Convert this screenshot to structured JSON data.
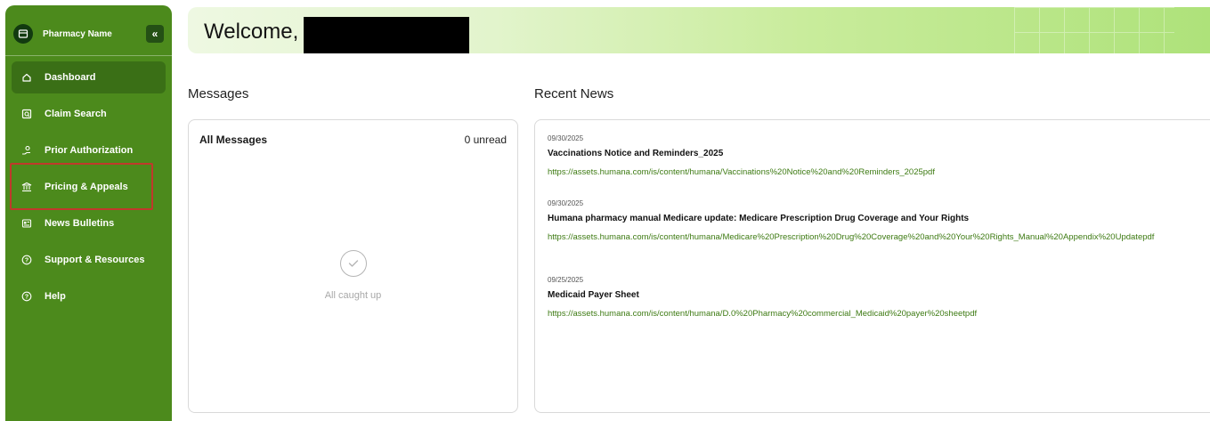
{
  "sidebar": {
    "brand_name": "Pharmacy Name",
    "collapse_label": "«",
    "items": [
      {
        "label": "Dashboard",
        "icon": "home-icon"
      },
      {
        "label": "Claim Search",
        "icon": "search-document-icon"
      },
      {
        "label": "Prior Authorization",
        "icon": "hand-coin-icon"
      },
      {
        "label": "Pricing & Appeals",
        "icon": "bank-icon"
      },
      {
        "label": "News Bulletins",
        "icon": "newspaper-icon"
      },
      {
        "label": "Support & Resources",
        "icon": "question-circle-icon"
      },
      {
        "label": "Help",
        "icon": "help-icon"
      }
    ],
    "active_item": "Dashboard",
    "highlighted_item": "Pricing & Appeals",
    "highlight_color": "#c0392b",
    "accent": "#4c8a1c"
  },
  "banner": {
    "welcome": "Welcome,"
  },
  "messages": {
    "heading": "Messages",
    "title": "All Messages",
    "unread": "0 unread",
    "empty_text": "All caught up"
  },
  "news": {
    "heading": "Recent News",
    "items": [
      {
        "date": "09/30/2025",
        "title": "Vaccinations Notice and Reminders_2025",
        "link": "https://assets.humana.com/is/content/humana/Vaccinations%20Notice%20and%20Reminders_2025pdf"
      },
      {
        "date": "09/30/2025",
        "title": "Humana pharmacy manual Medicare update: Medicare Prescription Drug Coverage and Your Rights",
        "link": "https://assets.humana.com/is/content/humana/Medicare%20Prescription%20Drug%20Coverage%20and%20Your%20Rights_Manual%20Appendix%20Updatepdf"
      },
      {
        "date": "09/25/2025",
        "title": "Medicaid Payer Sheet",
        "link": "https://assets.humana.com/is/content/humana/D.0%20Pharmacy%20commercial_Medicaid%20payer%20sheetpdf"
      }
    ]
  }
}
